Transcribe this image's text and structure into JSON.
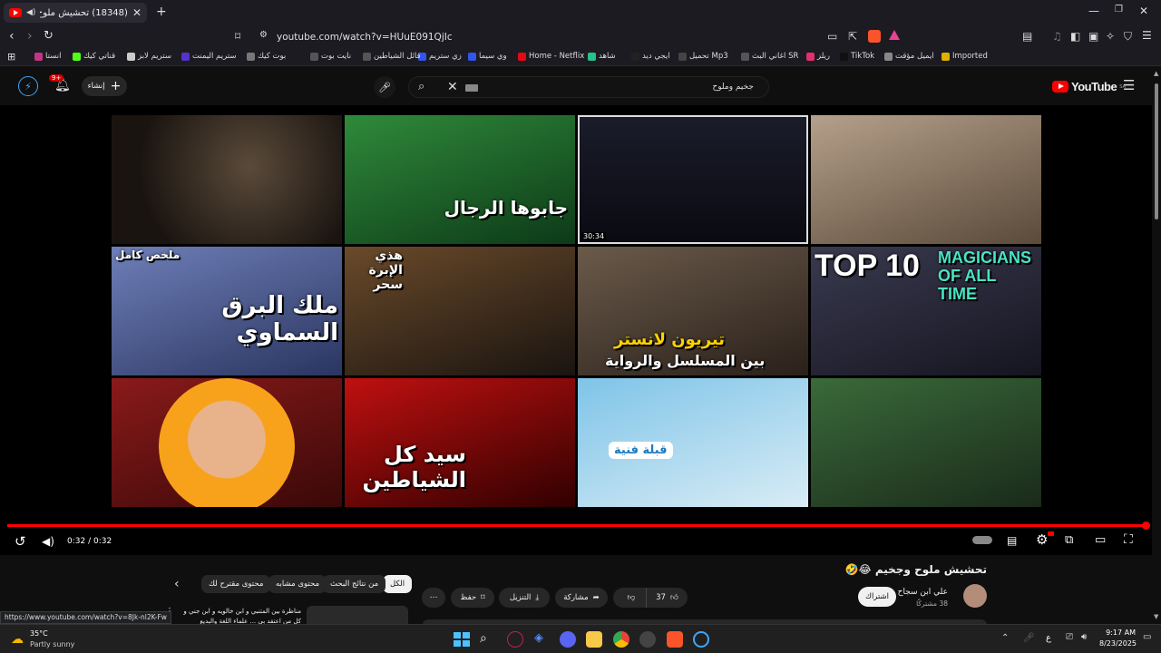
{
  "browser": {
    "tab_title": "(18348) تحشيش ملوح وجخيم",
    "url": "youtube.com/watch?v=HUuE091QjIc",
    "new_tab": "+",
    "status_url": "https://www.youtube.com/watch?v=8Jk-nl2K-Fw"
  },
  "bookmarks": [
    {
      "label": "Imported",
      "color": "#e0b000"
    },
    {
      "label": "ايميل مؤقت",
      "color": "#888888"
    },
    {
      "label": "TikTok",
      "color": "#111111"
    },
    {
      "label": "ريلز",
      "color": "#e1306c"
    },
    {
      "label": "اغاني البث SR",
      "color": "#555555"
    },
    {
      "label": "تحميل Mp3",
      "color": "#444444"
    },
    {
      "label": "ايجي ديد",
      "color": "#222222"
    },
    {
      "label": "شاهد",
      "color": "#27c18a"
    },
    {
      "label": "Home - Netflix",
      "color": "#e50914"
    },
    {
      "label": "وي سيما",
      "color": "#3355ee"
    },
    {
      "label": "زي ستريم",
      "color": "#3355ee"
    },
    {
      "label": "قائل الشياطين",
      "color": "#555555"
    },
    {
      "label": "نايت بوت",
      "color": "#555555"
    },
    {
      "label": "بوت كيك",
      "color": "#777777"
    },
    {
      "label": "ستريم اليمنت",
      "color": "#5533cc"
    },
    {
      "label": "ستريم لابز",
      "color": "#cccccc"
    },
    {
      "label": "قناتي كيك",
      "color": "#53fc18"
    },
    {
      "label": "انستا",
      "color": "#c13584"
    }
  ],
  "youtube": {
    "logo": "YouTube",
    "logo_sup": "SA",
    "search_value": "جخيم وملوح",
    "create_label": "إنشاء",
    "notif_count": "9+"
  },
  "thumbnails": [
    {
      "text": ""
    },
    {
      "text": "جابوها الرجال"
    },
    {
      "text": "",
      "duration": "30:34"
    },
    {
      "text": ""
    },
    {
      "text": "ملخص كامل",
      "text2": "ملك البرق السماوي"
    },
    {
      "text": "هذي الإبرة سحر"
    },
    {
      "text": "تيريون لانستر",
      "text2": "بين المسلسل والرواية"
    },
    {
      "text": "TOP 10",
      "text2": "MAGICIANS OF ALL TIME"
    },
    {
      "text": ""
    },
    {
      "text": "سيد كل الشياطين"
    },
    {
      "text": "قبلة فنية"
    },
    {
      "text": ""
    }
  ],
  "player": {
    "time": "0:32 / 0:32",
    "progress": 1.0
  },
  "video": {
    "title": "تحشيش ملوح وجخيم 😂🤣",
    "channel": "علي ابن سجاح",
    "subs": "38 مشتركًا",
    "subscribe": "اشتراك",
    "likes": "37",
    "share": "مشاركة",
    "download": "التنزيل",
    "save": "حفظ",
    "more": "⋯"
  },
  "chips": [
    "الكل",
    "من نتائج البحث",
    "محتوى مشابه",
    "محتوى مقترح لك"
  ],
  "related_title": "مناظرة بين المتنبي و ابن خالويه و ابن جني و كل من اعتقد بي ... علماء اللغة والبديع",
  "taskbar": {
    "temp": "35°C",
    "weather": "Partly sunny",
    "time": "9:17 AM",
    "date": "8/23/2025",
    "lang": "ع"
  }
}
